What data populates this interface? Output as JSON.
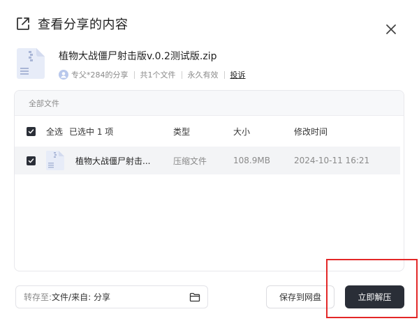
{
  "dialog": {
    "title": "查看分享的内容",
    "icons": {
      "share": "external-share-icon",
      "close": "close-icon"
    }
  },
  "file_summary": {
    "name": "植物大战僵尸射击版v.0.2测试版.zip",
    "sharer": "专父*284的分享",
    "file_count": "共1个文件",
    "validity": "永久有效",
    "report": "投诉"
  },
  "list": {
    "breadcrumb": "全部文件",
    "header": {
      "select_all": "全选",
      "selected_count": "已选中 1 项",
      "type": "类型",
      "size": "大小",
      "modified": "修改时间"
    },
    "rows": [
      {
        "name": "植物大战僵尸射击...",
        "type": "压缩文件",
        "size": "108.9MB",
        "modified": "2024-10-11 16:21",
        "checked": true
      }
    ]
  },
  "footer": {
    "save_to_prefix": "转存至:",
    "save_to_value": "文件/来自: 分享",
    "save_button": "保存到网盘",
    "extract_button": "立即解压"
  },
  "colors": {
    "primary_button": "#2a2e37",
    "highlight": "#e32727",
    "muted_text": "#8a8a8a"
  }
}
